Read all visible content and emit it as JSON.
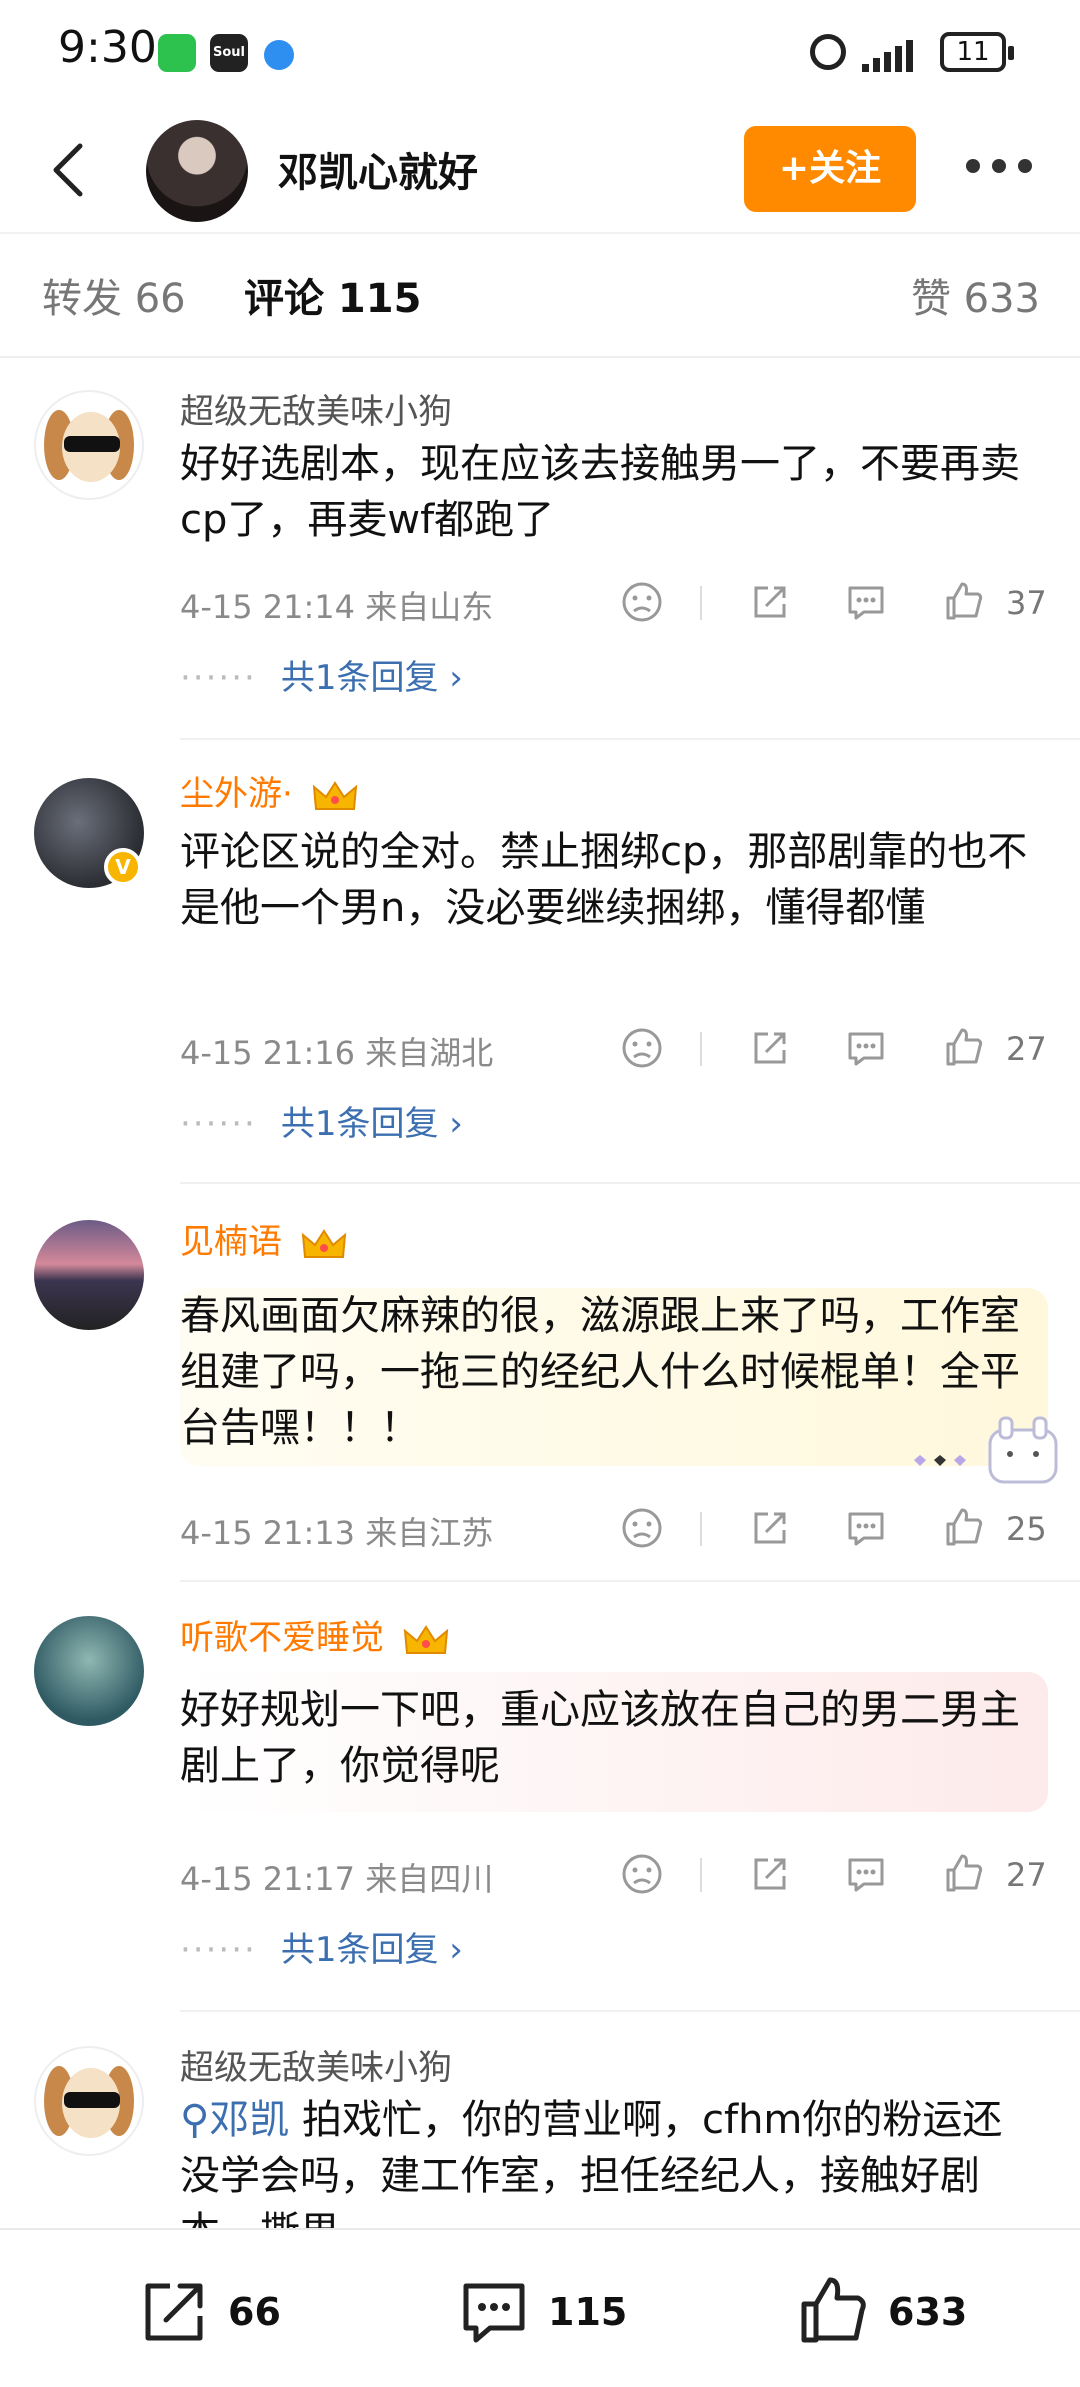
{
  "status_bar": {
    "time": "9:30",
    "battery": "11",
    "app_icons": [
      "wechat-icon",
      "soul-icon",
      "browser-icon"
    ]
  },
  "header": {
    "title": "邓凯心就好",
    "follow_label": "+关注"
  },
  "tabs": {
    "repost": "转发 66",
    "comments": "评论 115",
    "likes": "赞 633"
  },
  "comments": [
    {
      "name": "超级无敌美味小狗",
      "text": "好好选剧本，现在应该去接触男一了，不要再卖cp了，再麦wf都跑了",
      "time": "4-15 21:14 来自山东",
      "likes": "37",
      "replies": "共1条回复"
    },
    {
      "name": "尘外游·",
      "verified": "V",
      "text": "评论区说的全对。禁止捆绑cp，那部剧靠的也不是他一个男n，没必要继续捆绑，懂得都懂",
      "time": "4-15 21:16 来自湖北",
      "likes": "27",
      "replies": "共1条回复"
    },
    {
      "name": "见楠语",
      "text": "春风画面欠麻辣的很，滋源跟上来了吗，工作室组建了吗，一拖三的经纪人什么时候棍单！全平台告嘿！！！",
      "time": "4-15 21:13 来自江苏",
      "likes": "25"
    },
    {
      "name": "听歌不爱睡觉",
      "text": "好好规划一下吧，重心应该放在自己的男二男主剧上了，你觉得呢",
      "time": "4-15 21:17 来自四川",
      "likes": "27",
      "replies": "共1条回复"
    },
    {
      "name": "超级无敌美味小狗",
      "mention": "邓凯",
      "text": " 拍戏忙，你的营业啊，cfhm你的粉运还没学会吗，建工作室，担任经纪人，接触好剧本，撕男"
    }
  ],
  "bottom_bar": {
    "repost_count": "66",
    "comment_count": "115",
    "like_count": "633"
  },
  "colors": {
    "accent": "#ff8a00",
    "vip_name": "#ff7a00",
    "link": "#3c6fb0"
  }
}
